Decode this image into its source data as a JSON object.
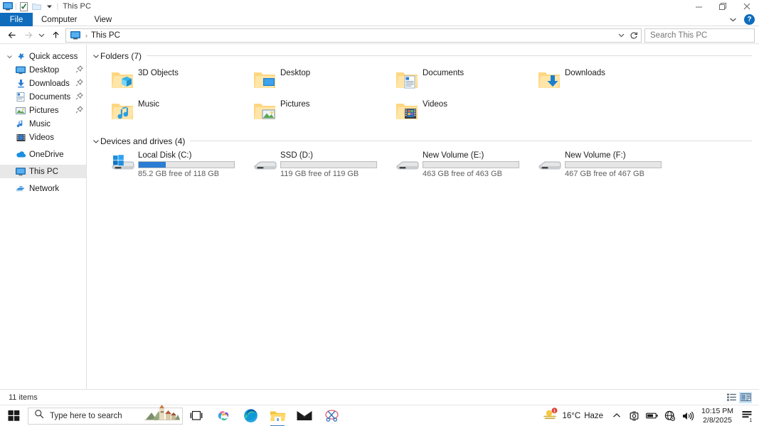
{
  "window": {
    "title": "This PC",
    "quick_access_toolbar": [
      {
        "name": "this-pc-icon",
        "label": "This PC"
      },
      {
        "name": "properties-icon",
        "label": "Properties"
      },
      {
        "name": "new-folder-icon",
        "label": "New folder"
      },
      {
        "name": "customize-dropdown-icon",
        "label": "Customize Quick Access Toolbar"
      }
    ],
    "controls": {
      "minimize": "Minimize",
      "restore": "Restore Down",
      "close": "Close",
      "ribbon_toggle": "Expand the Ribbon",
      "help": "?"
    }
  },
  "ribbon": {
    "tabs": [
      {
        "label": "File",
        "active": true
      },
      {
        "label": "Computer",
        "active": false
      },
      {
        "label": "View",
        "active": false
      }
    ]
  },
  "address_bar": {
    "back": "Back",
    "forward": "Forward",
    "recent": "Recent locations",
    "up": "Up one level",
    "breadcrumb_icon": "this-pc-icon",
    "breadcrumb": "This PC",
    "separator": "›",
    "dropdown": "Previous locations",
    "refresh": "Refresh"
  },
  "search": {
    "placeholder": "Search This PC",
    "value": ""
  },
  "sidebar": {
    "items": [
      {
        "label": "Quick access",
        "icon": "star-pin-icon",
        "level": 0,
        "chevron": "expanded",
        "pinned": false,
        "selected": false
      },
      {
        "label": "Desktop",
        "icon": "desktop-icon",
        "level": 1,
        "chevron": "",
        "pinned": true,
        "selected": false
      },
      {
        "label": "Downloads",
        "icon": "downloads-icon",
        "level": 1,
        "chevron": "",
        "pinned": true,
        "selected": false
      },
      {
        "label": "Documents",
        "icon": "documents-icon",
        "level": 1,
        "chevron": "",
        "pinned": true,
        "selected": false
      },
      {
        "label": "Pictures",
        "icon": "pictures-icon",
        "level": 1,
        "chevron": "",
        "pinned": true,
        "selected": false
      },
      {
        "label": "Music",
        "icon": "music-icon",
        "level": 1,
        "chevron": "",
        "pinned": false,
        "selected": false
      },
      {
        "label": "Videos",
        "icon": "videos-icon",
        "level": 1,
        "chevron": "",
        "pinned": false,
        "selected": false
      },
      {
        "label": "OneDrive",
        "icon": "onedrive-icon",
        "level": 0,
        "chevron": "",
        "pinned": false,
        "selected": false
      },
      {
        "label": "This PC",
        "icon": "this-pc-icon",
        "level": 0,
        "chevron": "",
        "pinned": false,
        "selected": true
      },
      {
        "label": "Network",
        "icon": "network-icon",
        "level": 0,
        "chevron": "",
        "pinned": false,
        "selected": false
      }
    ]
  },
  "main": {
    "groups": [
      {
        "title": "Folders (7)",
        "items": [
          {
            "label": "3D Objects",
            "icon": "folder-3d-objects-icon"
          },
          {
            "label": "Desktop",
            "icon": "folder-desktop-icon"
          },
          {
            "label": "Documents",
            "icon": "folder-documents-icon"
          },
          {
            "label": "Downloads",
            "icon": "folder-downloads-icon"
          },
          {
            "label": "Music",
            "icon": "folder-music-icon"
          },
          {
            "label": "Pictures",
            "icon": "folder-pictures-icon"
          },
          {
            "label": "Videos",
            "icon": "folder-videos-icon"
          }
        ]
      }
    ],
    "drives_group_title": "Devices and drives (4)",
    "drives": [
      {
        "name": "Local Disk (C:)",
        "free_text": "85.2 GB free of 118 GB",
        "used_percent": 28,
        "icon": "windows-drive-icon",
        "show_bar_fill": true
      },
      {
        "name": "SSD (D:)",
        "free_text": "119 GB free of 119 GB",
        "used_percent": 0,
        "icon": "drive-icon",
        "show_bar_fill": false
      },
      {
        "name": "New Volume (E:)",
        "free_text": "463 GB free of 463 GB",
        "used_percent": 0,
        "icon": "drive-icon",
        "show_bar_fill": false
      },
      {
        "name": "New Volume (F:)",
        "free_text": "467 GB free of 467 GB",
        "used_percent": 0,
        "icon": "drive-icon",
        "show_bar_fill": false
      }
    ]
  },
  "status_bar": {
    "item_count": "11 items",
    "views": [
      {
        "name": "details-view-button",
        "label": "Details view",
        "active": false
      },
      {
        "name": "large-icons-view-button",
        "label": "Large icons view",
        "active": true
      }
    ]
  },
  "taskbar": {
    "start": "Start",
    "search_placeholder": "Type here to search",
    "task_view": "Task View",
    "apps": [
      {
        "name": "copilot-taskbar-icon",
        "label": "Copilot",
        "active": false
      },
      {
        "name": "edge-taskbar-icon",
        "label": "Microsoft Edge",
        "active": false
      },
      {
        "name": "file-explorer-taskbar-icon",
        "label": "File Explorer",
        "active": true
      },
      {
        "name": "mail-taskbar-icon",
        "label": "Mail",
        "active": false
      },
      {
        "name": "snipping-tool-taskbar-icon",
        "label": "Snipping Tool",
        "active": false
      }
    ],
    "tray": {
      "weather_temp": "16°C",
      "weather_condition": "Haze",
      "show_hidden_icons": "Show hidden icons",
      "icons": [
        {
          "name": "webcam-tray-icon",
          "label": "Camera"
        },
        {
          "name": "battery-tray-icon",
          "label": "Battery"
        },
        {
          "name": "network-tray-icon",
          "label": "Network"
        },
        {
          "name": "volume-tray-icon",
          "label": "Volume"
        }
      ],
      "time": "10:15 PM",
      "date": "2/8/2025",
      "notification_count": "1",
      "action_center": "Notifications"
    }
  },
  "colors": {
    "accent": "#0f6cbd",
    "bar_fill": "#2b7cd3",
    "selection": "#e8e8e8",
    "folder_yellow": "#ffd782"
  }
}
